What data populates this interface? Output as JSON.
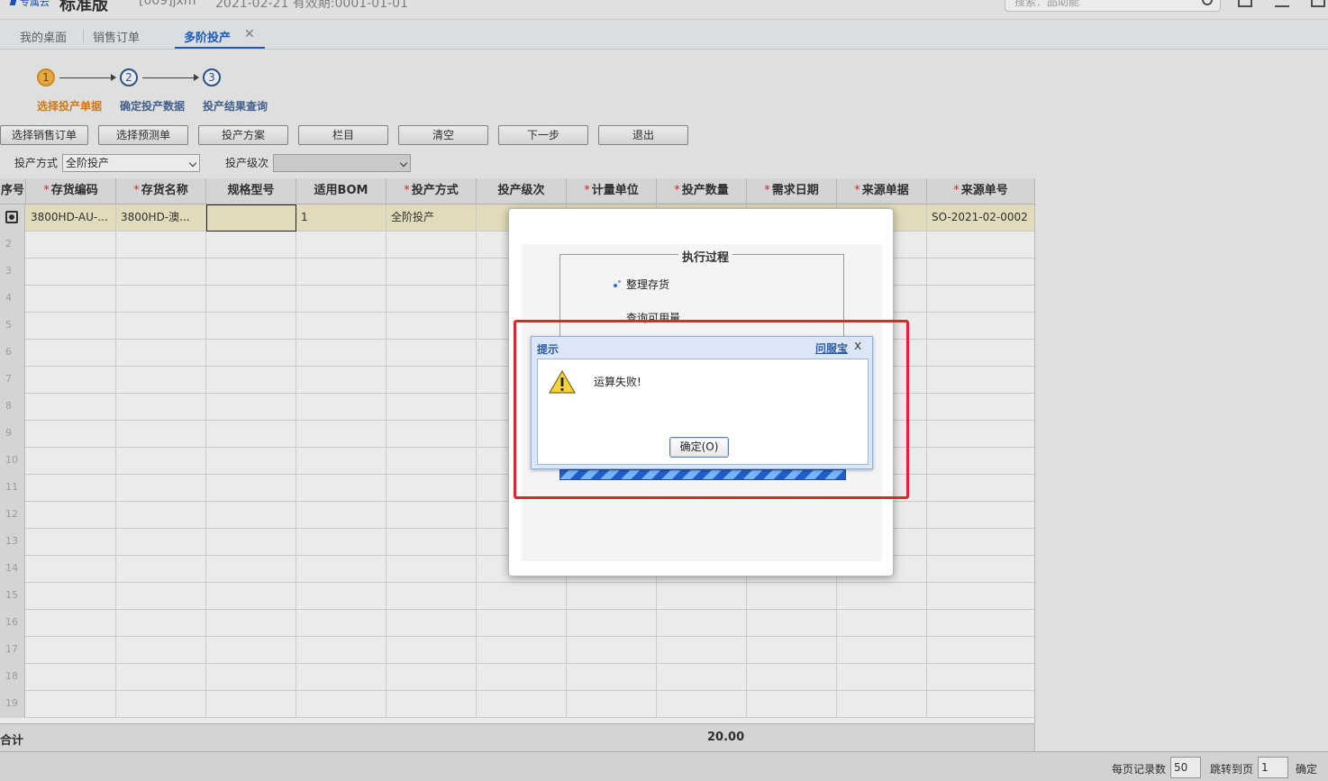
{
  "topbar": {
    "logo_text": "专属云",
    "brand": "标准版",
    "account": "[009]jxm",
    "date_info": "2021-02-21    有效期:0001-01-01",
    "search_placeholder": "搜索：品助能"
  },
  "tabs": [
    {
      "label": "我的桌面"
    },
    {
      "label": "销售订单"
    },
    {
      "label": "多阶投产",
      "active": true
    }
  ],
  "steps": [
    {
      "num": "1",
      "label": "选择投产单据"
    },
    {
      "num": "2",
      "label": "确定投产数据"
    },
    {
      "num": "3",
      "label": "投产结果查询"
    }
  ],
  "toolbar": {
    "select_sales_order": "选择销售订单",
    "select_forecast": "选择预测单",
    "plan": "投产方案",
    "columns": "栏目",
    "clear": "清空",
    "next": "下一步",
    "exit": "退出"
  },
  "filters": {
    "mode_label": "投产方式",
    "mode_value": "全阶投产",
    "level_label": "投产级次",
    "level_value": ""
  },
  "grid": {
    "headers": [
      {
        "text": "序号",
        "req": false
      },
      {
        "text": "存货编码",
        "req": true
      },
      {
        "text": "存货名称",
        "req": true
      },
      {
        "text": "规格型号",
        "req": false
      },
      {
        "text": "适用BOM",
        "req": false
      },
      {
        "text": "投产方式",
        "req": true
      },
      {
        "text": "投产级次",
        "req": false
      },
      {
        "text": "计量单位",
        "req": true
      },
      {
        "text": "投产数量",
        "req": true
      },
      {
        "text": "需求日期",
        "req": true
      },
      {
        "text": "来源单据",
        "req": true
      },
      {
        "text": "来源单号",
        "req": true
      }
    ],
    "row1": {
      "code": "3800HD-AU-...",
      "name": "3800HD-澳...",
      "spec": "",
      "bom": "1",
      "mode": "全阶投产",
      "source_no": "SO-2021-02-0002"
    },
    "row_numbers": [
      "2",
      "3",
      "4",
      "5",
      "6",
      "7",
      "8",
      "9",
      "10",
      "11",
      "12",
      "13",
      "14",
      "15",
      "16",
      "17",
      "18",
      "19"
    ],
    "footer_label": "合计",
    "footer_total": "20.00"
  },
  "statusbar": {
    "per_page_label": "每页记录数",
    "per_page_value": "50",
    "jump_label": "跳转到页",
    "jump_value": "1",
    "confirm": "确定"
  },
  "process_dialog": {
    "legend": "执行过程",
    "task1": "整理存货",
    "task2": "查询可用量"
  },
  "message_dialog": {
    "title": "提示",
    "help_link": "问服宝",
    "close": "x",
    "message": "运算失败!",
    "ok_button": "确定(O)"
  },
  "colors": {
    "accent": "#1d61c6",
    "highlight": "#e8212a",
    "current_step": "#e0821c"
  }
}
